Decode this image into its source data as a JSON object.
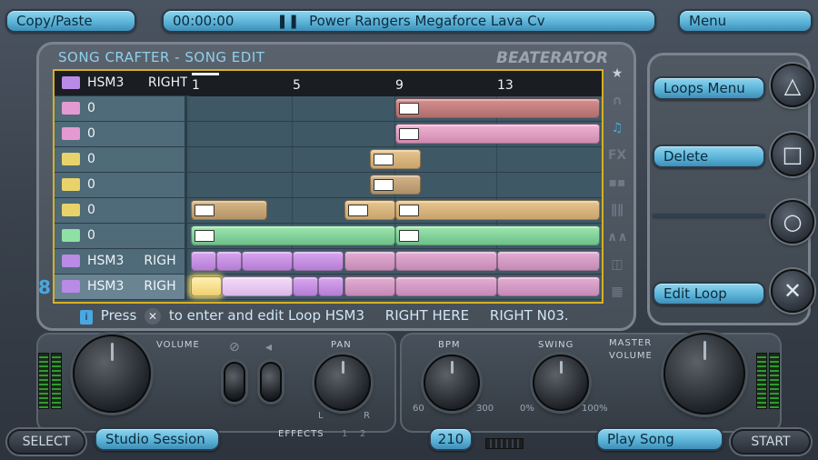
{
  "top_bar": {
    "copy_paste": "Copy/Paste",
    "time": "00:00:00",
    "song_title": "Power Rangers Megaforce Lava Cv",
    "menu": "Menu"
  },
  "panel": {
    "title": "SONG CRAFTER - SONG EDIT",
    "logo": "BEATERATOR"
  },
  "ruler": [
    "1",
    "5",
    "9",
    "13"
  ],
  "header_row": {
    "name": "HSM3",
    "extra": "RIGHT"
  },
  "tracks": [
    {
      "value": "0",
      "icon_color": "#e49ad0",
      "type": "keys"
    },
    {
      "value": "0",
      "icon_color": "#e49ad0",
      "type": "keys"
    },
    {
      "value": "0",
      "icon_color": "#e8d36a",
      "type": "keys"
    },
    {
      "value": "0",
      "icon_color": "#e8d36a",
      "type": "keys"
    },
    {
      "value": "0",
      "icon_color": "#e8d36a",
      "type": "keys"
    },
    {
      "value": "0",
      "icon_color": "#8fe0a4",
      "type": "keys"
    },
    {
      "value": "HSM3",
      "extra": "RIGH",
      "icon_color": "#b98ae6",
      "type": "loop"
    },
    {
      "value": "HSM3",
      "extra": "RIGH",
      "icon_color": "#b98ae6",
      "type": "loop"
    }
  ],
  "status_line": {
    "press": "Press",
    "rest": "to enter and edit Loop HSM3",
    "part2": "RIGHT HERE",
    "part3": "RIGHT N03."
  },
  "right_menu": {
    "loops_menu": "Loops Menu",
    "delete": "Delete",
    "blank": "",
    "edit_loop": "Edit Loop"
  },
  "face_buttons": {
    "triangle": "△",
    "square": "□",
    "circle": "○",
    "cross": "✕"
  },
  "side_number": "8",
  "controls": {
    "volume": "VOLUME",
    "pan": "PAN",
    "pan_l": "L",
    "pan_r": "R",
    "effects": "EFFECTS",
    "effects_1": "1",
    "effects_2": "2",
    "bpm": "BPM",
    "bpm_min": "60",
    "bpm_max": "300",
    "swing": "SWING",
    "swing_min": "0%",
    "swing_max": "100%",
    "master_volume_1": "MASTER",
    "master_volume_2": "VOLUME"
  },
  "bottom_bar": {
    "select": "SELECT",
    "studio_session": "Studio Session",
    "bpm_value": "210",
    "play_song": "Play Song",
    "start": "START"
  },
  "colors": {
    "accent": "#5cb4d8",
    "frame_border": "#d8b020"
  }
}
